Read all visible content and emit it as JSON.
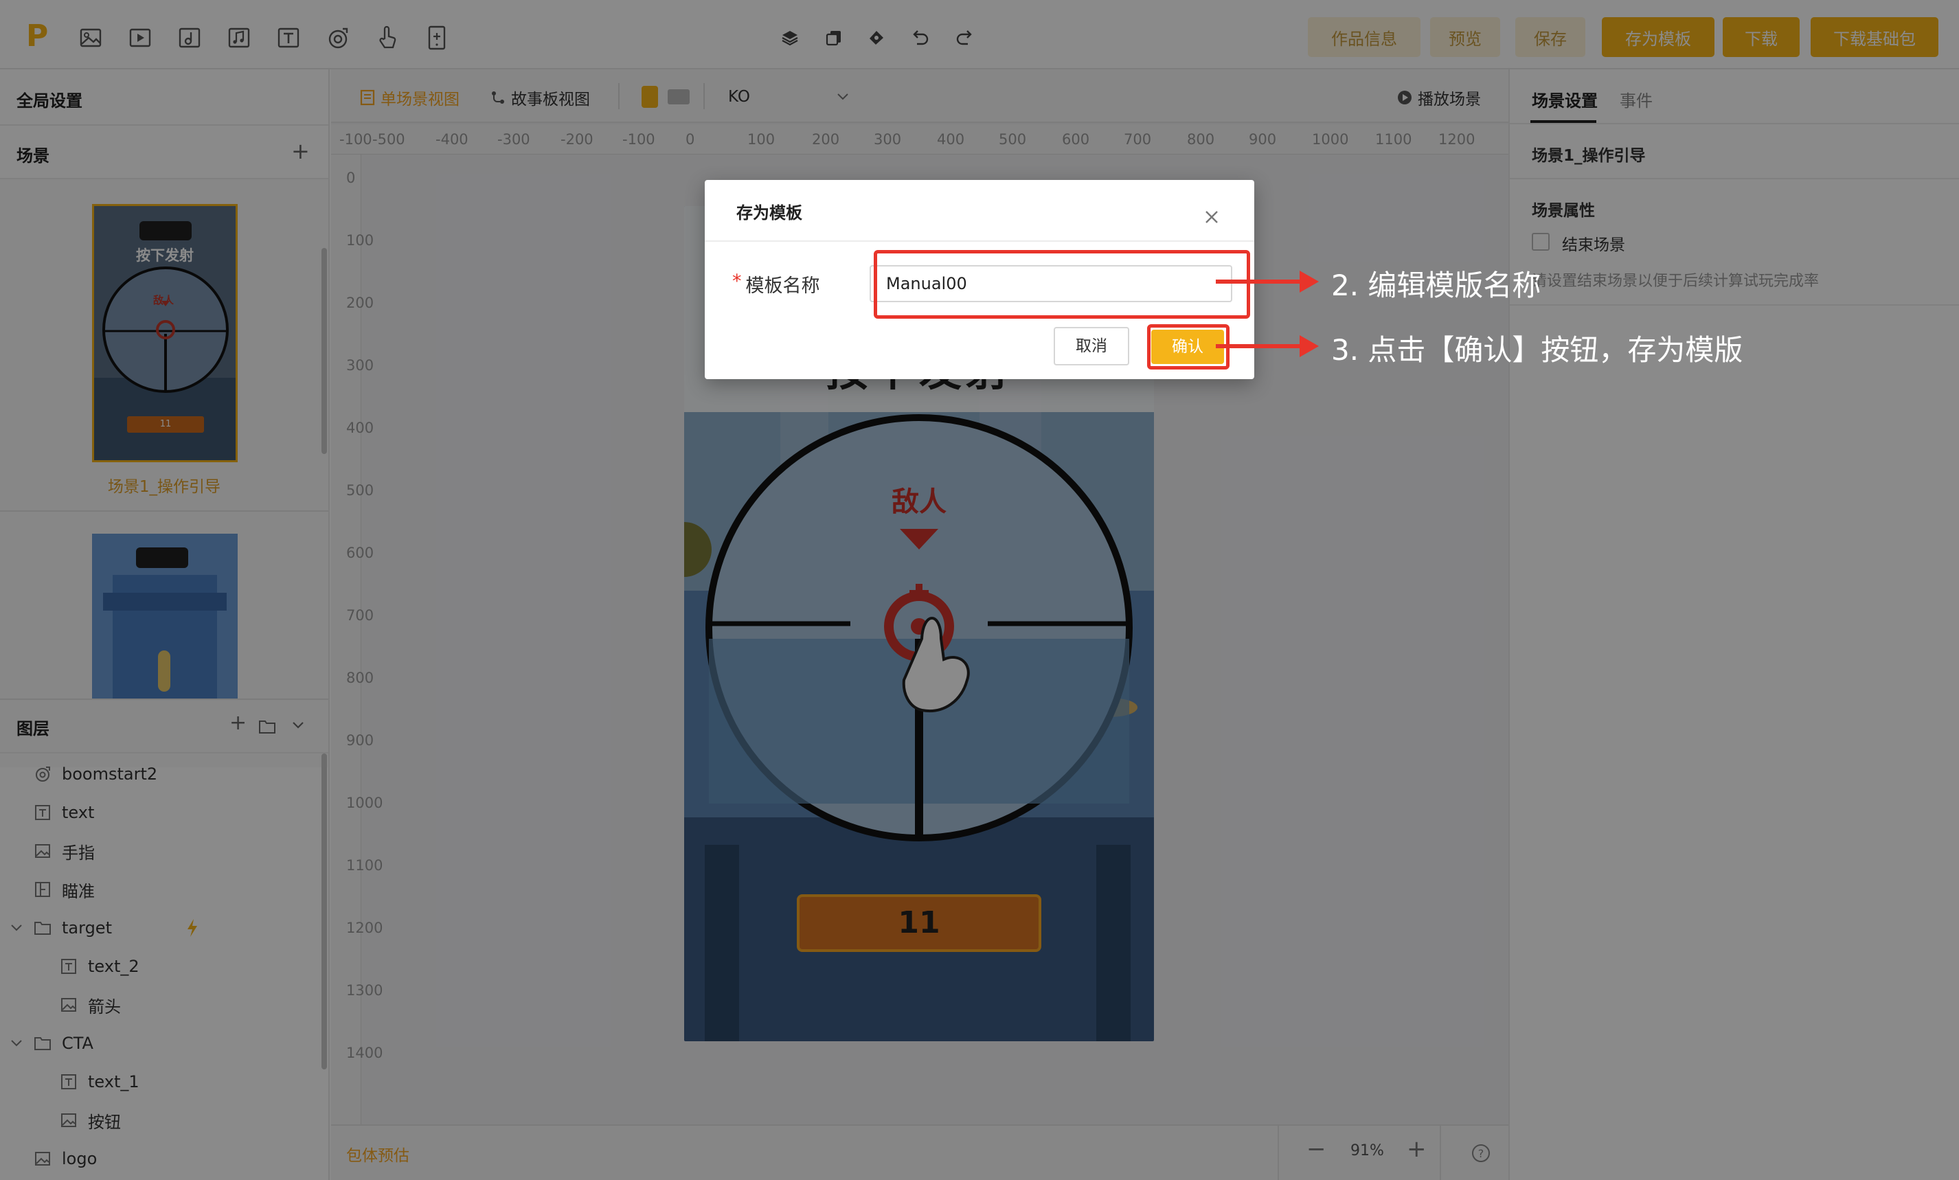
{
  "toolbar": {
    "logo": "P",
    "icons": [
      "image-icon",
      "video-icon",
      "audio-icon",
      "music-icon",
      "text-icon",
      "particle-icon",
      "gesture-icon",
      "mobile-icon"
    ],
    "center_icons": [
      "layers-icon",
      "copy-icon",
      "brush-icon",
      "undo-icon",
      "redo-icon"
    ],
    "buttons": {
      "work_info": "作品信息",
      "preview": "预览",
      "save": "保存",
      "save_template": "存为模板",
      "download": "下载",
      "download_base": "下载基础包"
    }
  },
  "left_panel": {
    "global_settings": "全局设置",
    "scenes_title": "场景",
    "scene1": {
      "name": "场景1_操作引导",
      "thumb_text": "按下发射",
      "thumb_enemy": "敌人",
      "thumb_badge": "11"
    },
    "layers_title": "图层",
    "layers": [
      {
        "label": "boomstart2",
        "icon": "particle-icon",
        "indent": 0
      },
      {
        "label": "text",
        "icon": "text-icon",
        "indent": 0
      },
      {
        "label": "手指",
        "icon": "image-icon",
        "indent": 0
      },
      {
        "label": "瞄准",
        "icon": "frames-icon",
        "indent": 0
      },
      {
        "label": "target",
        "icon": "folder-icon",
        "indent": 0,
        "expanded": true,
        "flash": true
      },
      {
        "label": "text_2",
        "icon": "text-icon",
        "indent": 1
      },
      {
        "label": "箭头",
        "icon": "image-icon",
        "indent": 1
      },
      {
        "label": "CTA",
        "icon": "folder-icon",
        "indent": 0,
        "expanded": true
      },
      {
        "label": "text_1",
        "icon": "text-icon",
        "indent": 1
      },
      {
        "label": "按钮",
        "icon": "image-icon",
        "indent": 1
      },
      {
        "label": "logo",
        "icon": "image-icon",
        "indent": 0
      }
    ]
  },
  "center": {
    "view_single": "单场景视图",
    "view_story": "故事板视图",
    "state_select": "KO",
    "play_scene": "播放场景",
    "ruler_h": [
      "-100",
      "-500",
      "-400",
      "-300",
      "-200",
      "-100",
      "0",
      "100",
      "200",
      "300",
      "400",
      "500",
      "600",
      "700",
      "800",
      "900",
      "1000",
      "1100",
      "1200"
    ],
    "ruler_v": [
      "0",
      "100",
      "200",
      "300",
      "400",
      "500",
      "600",
      "700",
      "800",
      "900",
      "1000",
      "1100",
      "1200",
      "1300",
      "1400"
    ],
    "package_estimate": "包体预估",
    "zoom": "91%",
    "canvas": {
      "title_partial": "按下发射",
      "enemy_label": "敌人",
      "button_number": "11"
    }
  },
  "right_panel": {
    "tab_scene_settings": "场景设置",
    "tab_events": "事件",
    "scene_name": "场景1_操作引导",
    "scene_props_title": "场景属性",
    "end_scene_label": "结束场景",
    "end_scene_checked": false,
    "end_scene_hint": "请设置结束场景以便于后续计算试玩完成率"
  },
  "modal": {
    "title": "存为模板",
    "field_required_mark": "*",
    "field_label": "模板名称",
    "field_value": "Manual00",
    "cancel_label": "取消",
    "confirm_label": "确认"
  },
  "annotations": {
    "step2": "2. 编辑模版名称",
    "step3": "3. 点击【确认】按钮，存为模版"
  },
  "colors": {
    "brand": "#f5b419",
    "annotation_red": "#e8342a",
    "overlay": "rgba(0,0,0,0.46)",
    "active_tab": "#f5a623"
  }
}
